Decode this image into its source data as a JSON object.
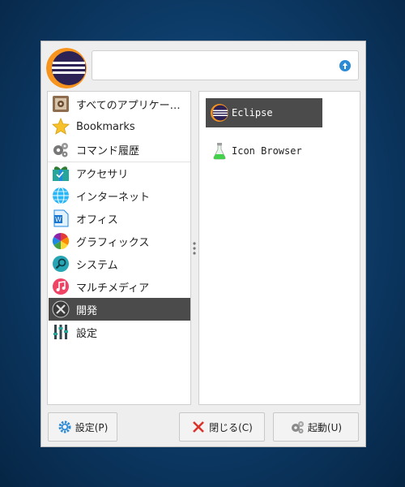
{
  "search": {
    "value": "",
    "placeholder": ""
  },
  "categories": [
    {
      "label": "すべてのアプリケー…",
      "icon": "all-apps-icon"
    },
    {
      "label": "Bookmarks",
      "icon": "star-icon"
    },
    {
      "label": "コマンド履歴",
      "icon": "gears-icon"
    },
    {
      "label": "アクセサリ",
      "icon": "accessories-icon"
    },
    {
      "label": "インターネット",
      "icon": "globe-icon"
    },
    {
      "label": "オフィス",
      "icon": "office-icon"
    },
    {
      "label": "グラフィックス",
      "icon": "color-wheel-icon"
    },
    {
      "label": "システム",
      "icon": "magnifier-icon"
    },
    {
      "label": "マルチメディア",
      "icon": "music-icon"
    },
    {
      "label": "開発",
      "icon": "tools-icon"
    },
    {
      "label": "設定",
      "icon": "sliders-icon"
    }
  ],
  "apps": [
    {
      "label": "Eclipse",
      "icon": "eclipse-icon"
    },
    {
      "label": "Icon Browser",
      "icon": "flask-icon"
    }
  ],
  "buttons": {
    "settings": "設定(P)",
    "close": "閉じる(C)",
    "launch": "起動(U)"
  },
  "colors": {
    "selected_bg": "#4b4b4b",
    "search_button": "#2d8bd6",
    "close_x": "#d9342b"
  }
}
